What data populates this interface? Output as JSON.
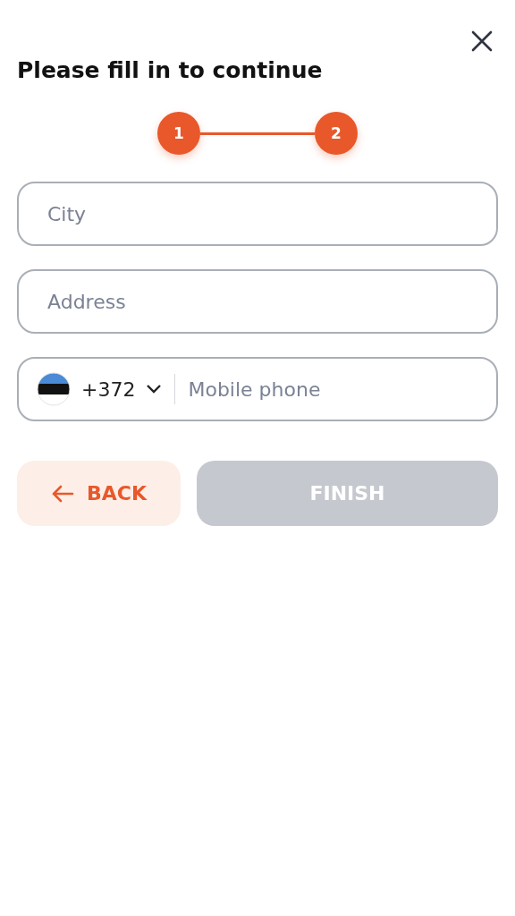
{
  "title": "Please fill in to continue",
  "steps": [
    {
      "label": "1",
      "active": true
    },
    {
      "label": "2",
      "active": true
    }
  ],
  "fields": [
    {
      "placeholder": "City"
    },
    {
      "placeholder": "Address"
    }
  ],
  "phone": {
    "code": "+372",
    "placeholder": "Mobile phone"
  },
  "buttons": {
    "back": {
      "label": "BACK",
      "disabled": false
    },
    "finish": {
      "label": "FINISH",
      "disabled": true
    }
  }
}
